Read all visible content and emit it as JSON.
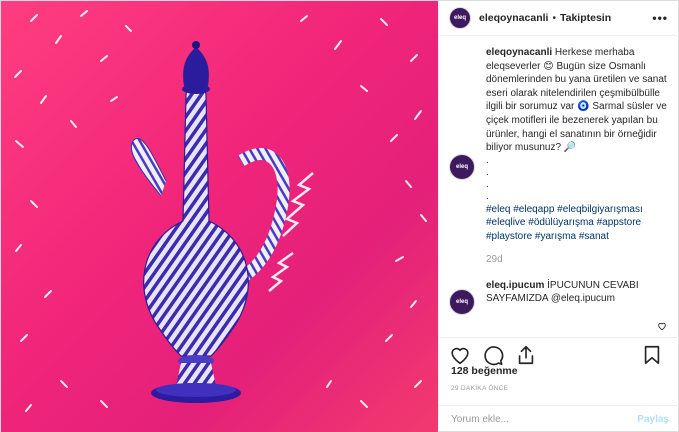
{
  "post": {
    "username": "eleqoynacanli",
    "separator": "•",
    "follow_status": "Takiptesin",
    "avatar_text": "eleq",
    "more_label": "•••"
  },
  "caption": {
    "username": "eleqoynacanli",
    "text": "Herkese merhaba eleqseverler 😊 Bugün size Osmanlı dönemlerinden bu yana üretilen ve sanat eseri olarak nitelendirilen çeşmibülbülle ilgili bir sorumuz var 🧿 Sarmal süsler ve çiçek motifleri ile bezenerek yapılan bu ürünler, hangi el sanatının bir örneğidir biliyor musunuz? 🔎",
    "dots": ".\n.\n.\n.",
    "hashtags": "#eleq #eleqapp #eleqbilgiyarışması #eleqlive #ödülüyarışma #appstore #playstore #yarışma #sanat",
    "time": "29d"
  },
  "reply": {
    "username": "eleq.ipucum",
    "text": "İPUCUNUN CEVABI SAYFAMIZDA @eleq.ipucum"
  },
  "likes": "128 beğenme",
  "time_ago": "29 DAKİKA ÖNCE",
  "comment_input": {
    "placeholder": "Yorum ekle...",
    "post_label": "Paylaş"
  },
  "colors": {
    "background_pink": "#f0257a",
    "vase_blue": "#2b1c9e",
    "link_blue": "#003569",
    "post_button": "#b2dffc"
  },
  "icons": [
    "heart-icon",
    "comment-icon",
    "share-icon",
    "bookmark-icon",
    "more-icon"
  ]
}
